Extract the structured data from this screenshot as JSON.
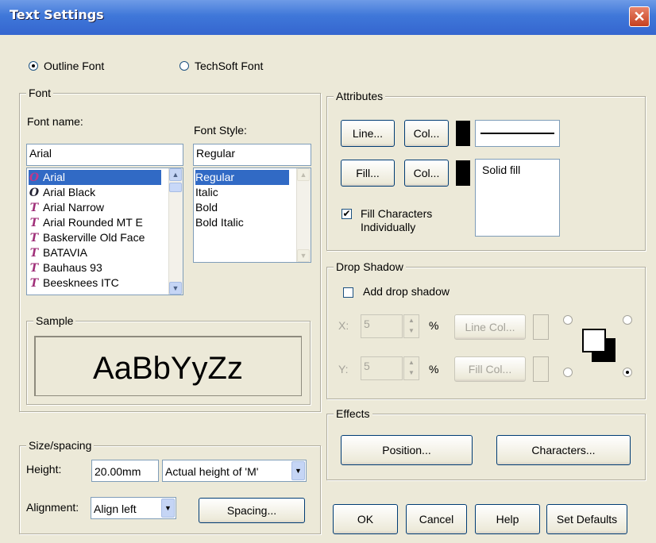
{
  "window": {
    "title": "Text Settings",
    "close": "✕"
  },
  "font_type": {
    "outline": "Outline Font",
    "techsoft": "TechSoft Font",
    "selected": "outline"
  },
  "font": {
    "legend": "Font",
    "name_label": "Font name:",
    "style_label": "Font Style:",
    "name_value": "Arial",
    "style_value": "Regular",
    "fonts": [
      "Arial",
      "Arial Black",
      "Arial Narrow",
      "Arial Rounded MT E",
      "Baskerville Old Facе",
      "BATAVIA",
      "Bauhaus 93",
      "Beesknees ITC"
    ],
    "font_icons": [
      "O",
      "O",
      "T",
      "T",
      "T",
      "T",
      "T",
      "T"
    ],
    "styles": [
      "Regular",
      "Italic",
      "Bold",
      "Bold Italic"
    ],
    "selected_font": "Arial",
    "selected_style": "Regular"
  },
  "sample": {
    "legend": "Sample",
    "text": "AaBbYyZz"
  },
  "size": {
    "legend": "Size/spacing",
    "height_label": "Height:",
    "height_value": "20.00mm",
    "height_mode": "Actual height of 'M'",
    "alignment_label": "Alignment:",
    "alignment_value": "Align left",
    "spacing_button": "Spacing..."
  },
  "attributes": {
    "legend": "Attributes",
    "line_button": "Line...",
    "col_button": "Col...",
    "fill_button": "Fill...",
    "fill_col_button": "Col...",
    "fill_style": "Solid fill",
    "fill_individually": "Fill Characters Individually",
    "fill_individually_checked": true,
    "line_color": "#000000",
    "fill_color": "#000000"
  },
  "shadow": {
    "legend": "Drop Shadow",
    "add_label": "Add drop shadow",
    "add_checked": false,
    "x_label": "X:",
    "x_value": "5",
    "y_label": "Y:",
    "y_value": "5",
    "unit": "%",
    "line_col": "Line Col...",
    "fill_col": "Fill Col..."
  },
  "effects": {
    "legend": "Effects",
    "position": "Position...",
    "characters": "Characters..."
  },
  "footer": {
    "ok": "OK",
    "cancel": "Cancel",
    "help": "Help",
    "defaults": "Set Defaults"
  }
}
